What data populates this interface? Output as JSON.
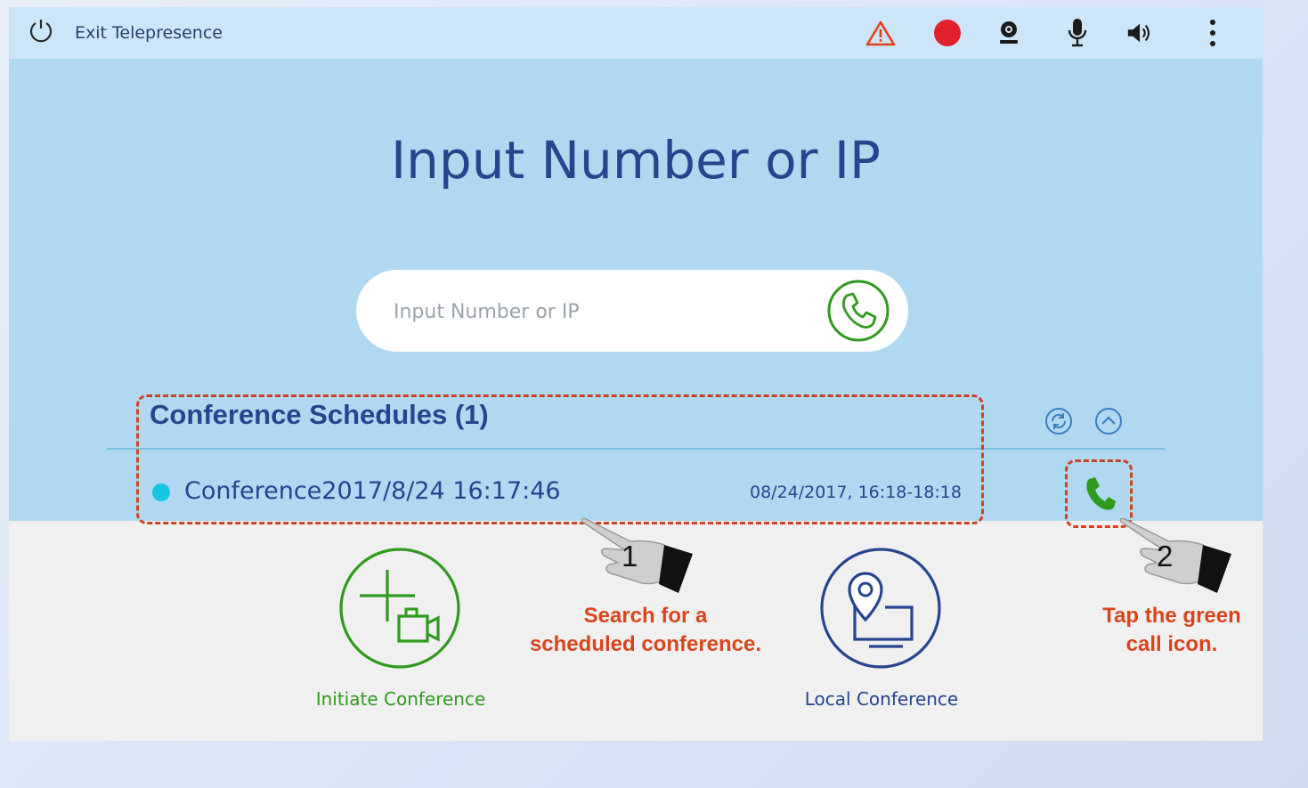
{
  "topbar": {
    "exit_label": "Exit Telepresence",
    "icons": [
      "power-icon",
      "warning-icon",
      "record-icon",
      "camera-icon",
      "microphone-icon",
      "speaker-icon",
      "more-vertical-icon"
    ]
  },
  "main": {
    "title": "Input Number or IP",
    "search": {
      "placeholder": "Input Number or IP",
      "value": ""
    }
  },
  "schedules": {
    "title": "Conference Schedules (1)",
    "items": [
      {
        "name": "Conference2017/8/24 16:17:46",
        "time": "08/24/2017, 16:18-18:18",
        "status_color": "#16c6e2"
      }
    ]
  },
  "actions": {
    "initiate_label": "Initiate Conference",
    "local_label": "Local Conference"
  },
  "callouts": {
    "step1": {
      "number": "1",
      "line1": "Search for a",
      "line2": "scheduled conference."
    },
    "step2": {
      "number": "2",
      "line1": "Tap the green",
      "line2": "call icon."
    }
  },
  "colors": {
    "accent_green": "#2f9a1e",
    "accent_blue": "#25458f",
    "callout_red": "#d0431f",
    "record_red": "#e0212b",
    "warning_orange": "#e3411b"
  }
}
